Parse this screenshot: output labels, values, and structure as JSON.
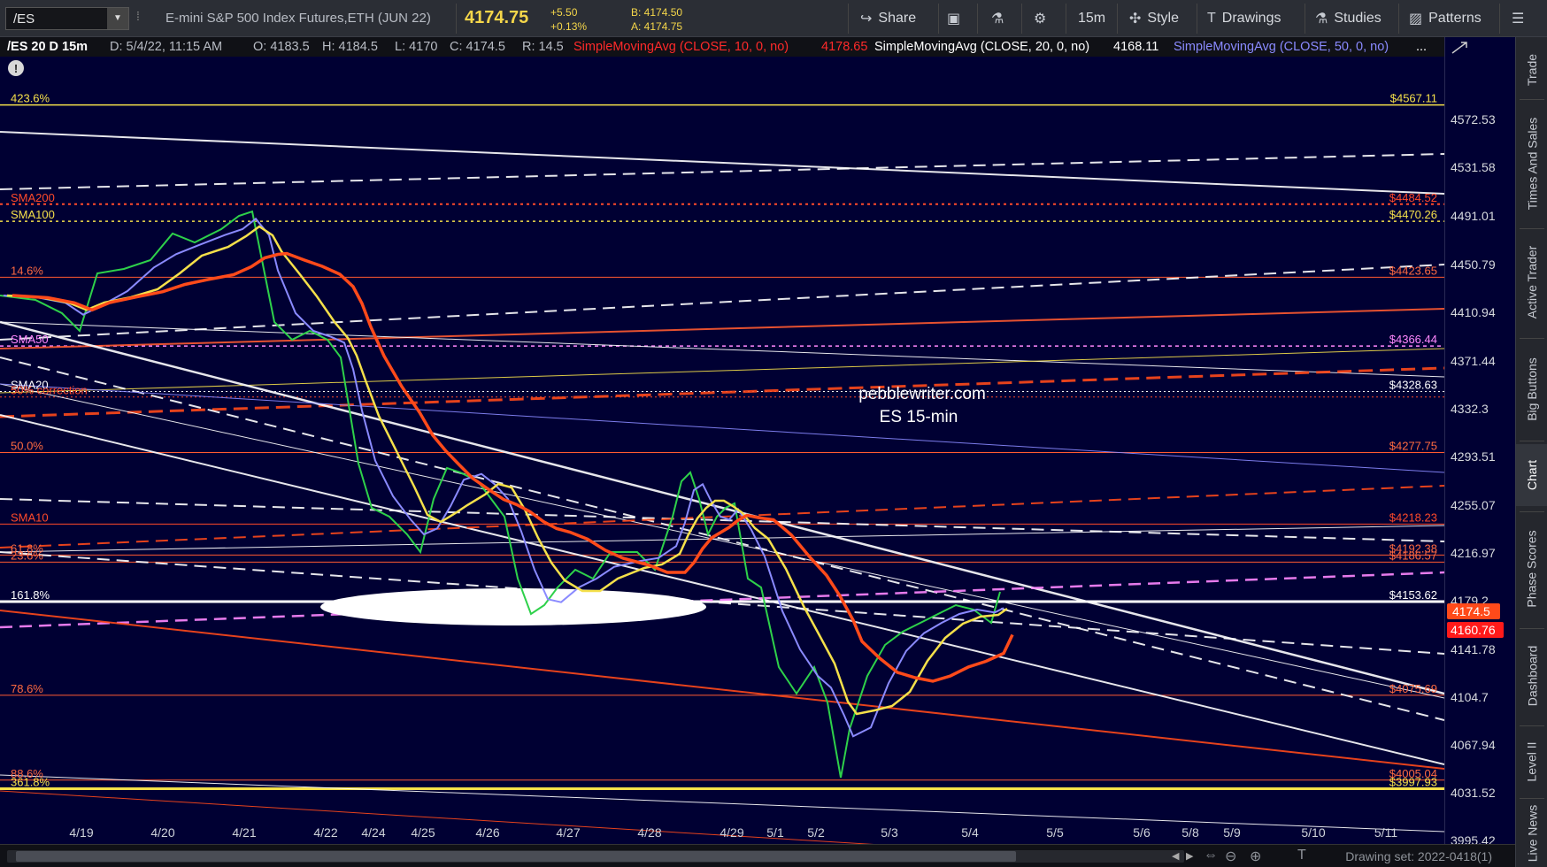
{
  "toolbar": {
    "symbol": "/ES",
    "instrument": "E-mini S&P 500 Index Futures,ETH (JUN 22)",
    "last_price": "4174.75",
    "change_abs": "+5.50",
    "change_pct": "+0.13%",
    "bid": "B: 4174.50",
    "ask": "A: 4174.75",
    "share_label": "Share",
    "timeframe_label": "15m",
    "style_label": "Style",
    "drawings_label": "Drawings",
    "studies_label": "Studies",
    "patterns_label": "Patterns"
  },
  "header": {
    "symbol_period": "/ES 20 D 15m",
    "date": "D: 5/4/22, 11:15 AM",
    "open": "O: 4183.5",
    "high": "H: 4184.5",
    "low": "L: 4170",
    "close": "C: 4174.5",
    "range": "R: 14.5",
    "sma10_label": "SimpleMovingAvg (CLOSE, 10, 0, no)",
    "sma10_value": "4178.65",
    "sma20_label": "SimpleMovingAvg (CLOSE, 20, 0, no)",
    "sma20_value": "4168.11",
    "sma50_label": "SimpleMovingAvg (CLOSE, 50, 0, no)",
    "more": "..."
  },
  "chart": {
    "watermark_line1": "pebblewriter.com",
    "watermark_line2": "ES 15-min",
    "left_labels": [
      {
        "text": "423.6%",
        "price": 4567.11,
        "color": "#f5e04a"
      },
      {
        "text": "SMA200",
        "price": 4484.52,
        "color": "#ff4a2a"
      },
      {
        "text": "SMA100",
        "price": 4470.26,
        "color": "#f5e04a"
      },
      {
        "text": "14.6%",
        "price": 4423.65,
        "color": "#ff6a40"
      },
      {
        "text": "SMA50",
        "price": 4366.44,
        "color": "#ff88ff"
      },
      {
        "text": "SMA20",
        "price": 4328.63,
        "color": "#ffffff"
      },
      {
        "text": "50% correction",
        "price": 4324.0,
        "color": "#ff4a2a"
      },
      {
        "text": "50.0%",
        "price": 4277.75,
        "color": "#ff6a40"
      },
      {
        "text": "SMA10",
        "price": 4218.23,
        "color": "#ff4a2a"
      },
      {
        "text": "61.8%",
        "price": 4192.3,
        "color": "#ff6a40"
      },
      {
        "text": "23.6%",
        "price": 4186.57,
        "color": "#ff6a40"
      },
      {
        "text": "161.8%",
        "price": 4153.62,
        "color": "#ffffff"
      },
      {
        "text": "78.6%",
        "price": 4075.69,
        "color": "#ff6a40"
      },
      {
        "text": "88.6%",
        "price": 4005.04,
        "color": "#ff6a40"
      },
      {
        "text": "361.8%",
        "price": 3997.93,
        "color": "#f5e04a"
      }
    ],
    "right_labels": [
      {
        "text": "$4567.11",
        "price": 4567.11,
        "color": "#f5e04a"
      },
      {
        "text": "$4484.52",
        "price": 4484.52,
        "color": "#ff4a2a"
      },
      {
        "text": "$4470.26",
        "price": 4470.26,
        "color": "#f5e04a"
      },
      {
        "text": "$4423.65",
        "price": 4423.65,
        "color": "#ff6a40"
      },
      {
        "text": "$4366.44",
        "price": 4366.44,
        "color": "#ff88ff"
      },
      {
        "text": "$4328.63",
        "price": 4328.63,
        "color": "#ffffff"
      },
      {
        "text": "$4277.75",
        "price": 4277.75,
        "color": "#ff6a40"
      },
      {
        "text": "$4218.23",
        "price": 4218.23,
        "color": "#ff4a2a"
      },
      {
        "text": "$4192.38",
        "price": 4192.38,
        "color": "#ff6a40"
      },
      {
        "text": "$4186.57",
        "price": 4186.57,
        "color": "#ff6a40"
      },
      {
        "text": "$4153.62",
        "price": 4153.62,
        "color": "#ffffff"
      },
      {
        "text": "$4075.69",
        "price": 4075.69,
        "color": "#ff6a40"
      },
      {
        "text": "$4005.04",
        "price": 4005.04,
        "color": "#ff6a40"
      },
      {
        "text": "$3997.93",
        "price": 3997.93,
        "color": "#f5e04a"
      }
    ],
    "price_ticks": [
      "4572.53",
      "4531.58",
      "4491.01",
      "4450.79",
      "4410.94",
      "4371.44",
      "4332.3",
      "4293.51",
      "4255.07",
      "4216.97",
      "4179.2",
      "4141.78",
      "4104.7",
      "4067.94",
      "4031.52",
      "3995.42"
    ],
    "price_min": 3985,
    "price_max": 4600,
    "date_ticks": [
      "4/19",
      "4/20",
      "4/21",
      "4/22",
      "4/24",
      "4/25",
      "4/26",
      "4/27",
      "4/28",
      "4/29",
      "5/1",
      "5/2",
      "5/3",
      "5/4",
      "5/5",
      "5/6",
      "5/8",
      "5/9",
      "5/10",
      "5/11"
    ],
    "price_bubble_1": "4174.5",
    "price_bubble_2": "4160.76",
    "colors": {
      "background": "#000033",
      "sma10": "#8a8aff",
      "sma20": "#f5e04a",
      "sma50": "#ff4a1a",
      "bubble1": "#ff4a1a",
      "bubble2": "#ff1a1a"
    }
  },
  "rail": {
    "items": [
      "Trade",
      "Times And Sales",
      "Active Trader",
      "Big Buttons",
      "Chart",
      "Phase Scores",
      "Dashboard",
      "Level II",
      "Live News"
    ]
  },
  "bottom": {
    "drawing_set": "Drawing set: 2022-0418(1)"
  }
}
